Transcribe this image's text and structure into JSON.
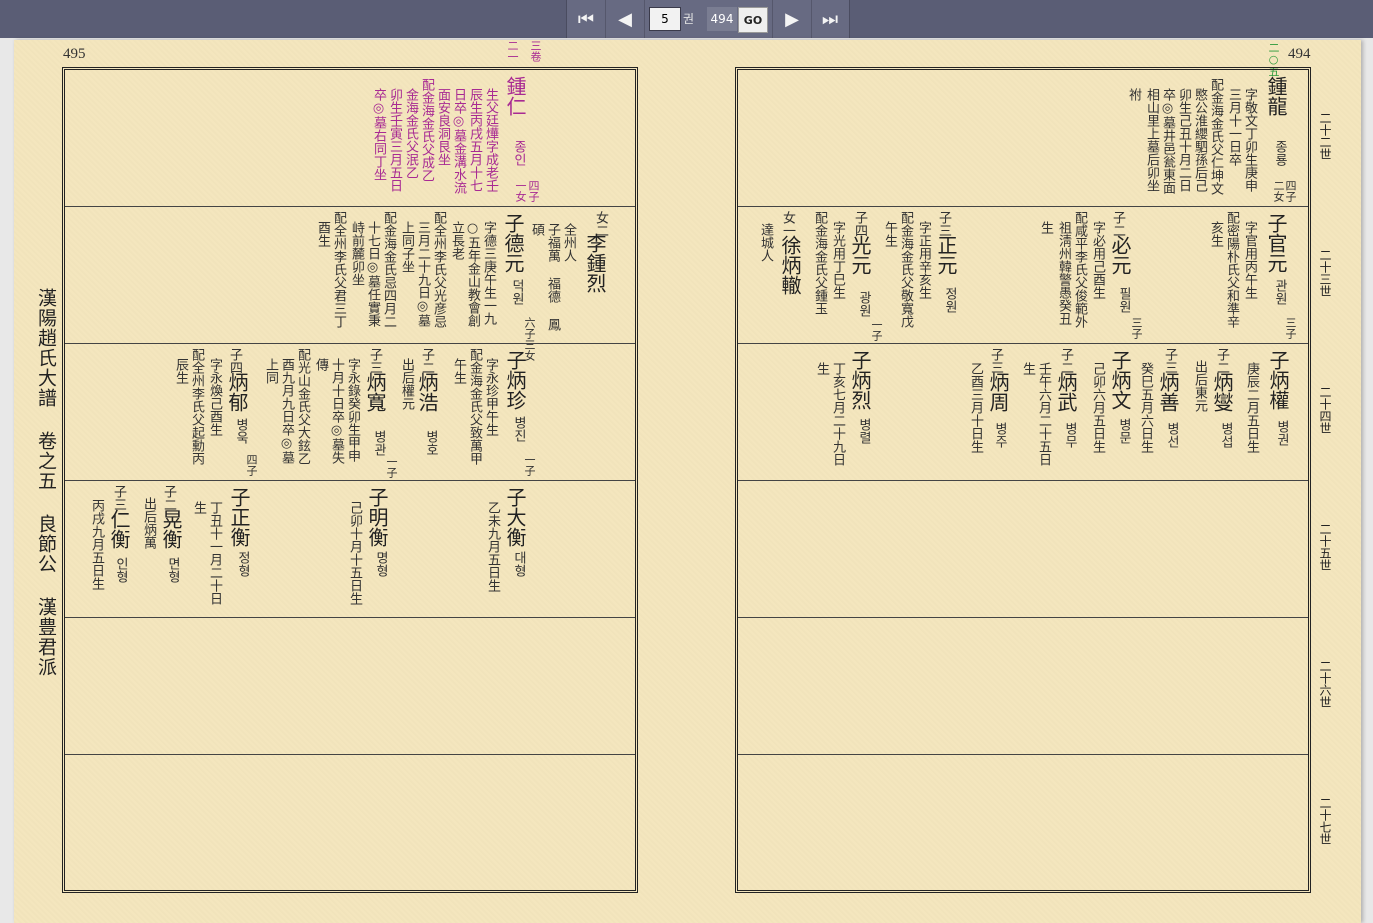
{
  "toolbar": {
    "first_icon": "⏮",
    "prev_icon": "◀",
    "page_value": "5",
    "vol_label": "권",
    "total_pages": "494",
    "go_label": "GO",
    "next_icon": "▶",
    "last_icon": "⏭"
  },
  "book_title": "漢陽趙氏大譜 卷之五 良節公 漢豊君派",
  "left_page": {
    "number": "495",
    "corner_mark_1": "三卷",
    "corner_mark_2": "二一",
    "r1": {
      "name": "鍾仁",
      "name_kor": "종인",
      "rank": "四子",
      "rank2": "一女",
      "bio": [
        "生父廷燁字成老壬",
        "辰生丙戌五月十七",
        "日卒◎墓金溝水流",
        "面安良洞艮坐",
        "配金海金氏父成乙",
        "金海金氏父泯乙",
        "卯生壬寅三月五日",
        "卒◎墓右同丁坐"
      ]
    },
    "r2": {
      "girl_rank": "女二",
      "girl_name": "李鍾烈",
      "girl_notes": [
        "全州人",
        "子福萬 福德 鳳",
        "碩"
      ],
      "son_name": "子德元",
      "son_kor": "덕원",
      "son_rank": "六子三女",
      "son_bio": [
        "字德三庚午生一九",
        "○五年金山教會創",
        "立長老",
        "配全州李氏父光彦忌",
        "三月二十九日◎墓",
        "上同子坐",
        "配金海金氏忌四月二",
        "十七日◎墓任實秉",
        "峙前麓卯坐",
        "配全州李氏父君三丁",
        "酉生"
      ]
    },
    "r3": {
      "c1_name": "子炳珍",
      "c1_kor": "병진",
      "c1_rank": "一子",
      "c1_bio": [
        "字永珍甲午生",
        "配金海金氏父致萬甲",
        "午生"
      ],
      "c2_rank": "子二",
      "c2_name": "炳浩",
      "c2_kor": "병호",
      "c2_bio": [
        "出后權元"
      ],
      "c3_rank": "子三",
      "c3_name": "炳寬",
      "c3_kor": "병관",
      "c3_rank2": "一子",
      "c3_bio": [
        "字永錄癸卯生甲申",
        "十月十日卒◎墓失",
        "傳",
        "配光山金氏父大鉉乙",
        "酉九月九日卒◎墓",
        "上同"
      ],
      "c4_rank": "子四",
      "c4_name": "炳郁",
      "c4_kor": "병욱",
      "c4_rank2": "四子",
      "c4_bio": [
        "字永煥己酉生",
        "配全州李氏父起勳丙",
        "辰生"
      ]
    },
    "r4": {
      "a_name": "子大衡",
      "a_kor": "대형",
      "a_bio": [
        "乙未九月五日生"
      ],
      "b_name": "子明衡",
      "b_kor": "명형",
      "b_bio": [
        "己卯十月十五日生"
      ],
      "c_name": "子正衡",
      "c_kor": "정형",
      "c_bio": [
        "丁丑十一月二十日",
        "生"
      ],
      "d_rank": "子二",
      "d_name": "晃衡",
      "d_kor": "면형",
      "d_bio": [
        "出后炳萬"
      ],
      "e_rank": "子三",
      "e_name": "仁衡",
      "e_kor": "인형",
      "e_bio": [
        "丙戌九月五日生"
      ]
    }
  },
  "right_page": {
    "number": "494",
    "corner_mark": "二○五",
    "r1": {
      "name": "鍾龍",
      "name_kor": "종룡",
      "rank": "四子",
      "rank2": "二女",
      "bio": [
        "字敬文丁卯生庚申",
        "三月十一日卒",
        "配金海金氏父仁坤文",
        "愍公淮纓駟孫后己",
        "卯生己丑十月二日",
        "卒◎墓井邑瓮東面",
        "相山里上墓后卯坐",
        "祔"
      ]
    },
    "r2": {
      "a_name": "子官元",
      "a_kor": "관원",
      "a_rank": "三子",
      "a_bio": [
        "字官用丙午生",
        "配密陽朴氏父和準辛",
        "亥生"
      ],
      "b_rank": "子二",
      "b_name": "必元",
      "b_kor": "필원",
      "b_rank2": "三子",
      "b_bio": [
        "字必用己酉生",
        "配咸平李氏父俊範外",
        "祖淸州韓警愚癸丑",
        "生"
      ],
      "c_rank": "子三",
      "c_name": "正元",
      "c_kor": "정원",
      "c_bio": [
        "字正用辛亥生",
        "配金海金氏父敬寬戊",
        "午生"
      ],
      "d_rank": "子四",
      "d_name": "光元",
      "d_kor": "광원",
      "d_rank2": "一子",
      "d_bio": [
        "字光用丁巳生",
        "配金海金氏父鍾玉"
      ],
      "e_rank": "女一",
      "e_name": "徐炳轍",
      "e_bio": [
        "達城人"
      ]
    },
    "r3": {
      "a_name": "子炳權",
      "a_kor": "병권",
      "a_bio": [
        "庚辰二月五日生"
      ],
      "b_rank": "子二",
      "b_name": "炳燮",
      "b_kor": "병섭",
      "b_bio": [
        "出后東元"
      ],
      "c_rank": "子三",
      "c_name": "炳善",
      "c_kor": "병선",
      "c_bio": [
        "癸巳五月六日生"
      ],
      "d_name": "子炳文",
      "d_kor": "병문",
      "d_bio": [
        "己卯六月五日生"
      ],
      "e_rank": "子二",
      "e_name": "炳武",
      "e_kor": "병무",
      "e_bio": [
        "壬午六月二十五日",
        "生"
      ],
      "f_rank": "子三",
      "f_name": "炳周",
      "f_kor": "병주",
      "f_bio": [
        "乙酉三月十日生"
      ],
      "g_name": "子炳烈",
      "g_kor": "병렬",
      "g_bio": [
        "丁亥七月二十九日",
        "生"
      ]
    }
  },
  "generations": [
    "二十二世",
    "二十三世",
    "二十四世",
    "二十五世",
    "二十六世",
    "二十七世"
  ]
}
